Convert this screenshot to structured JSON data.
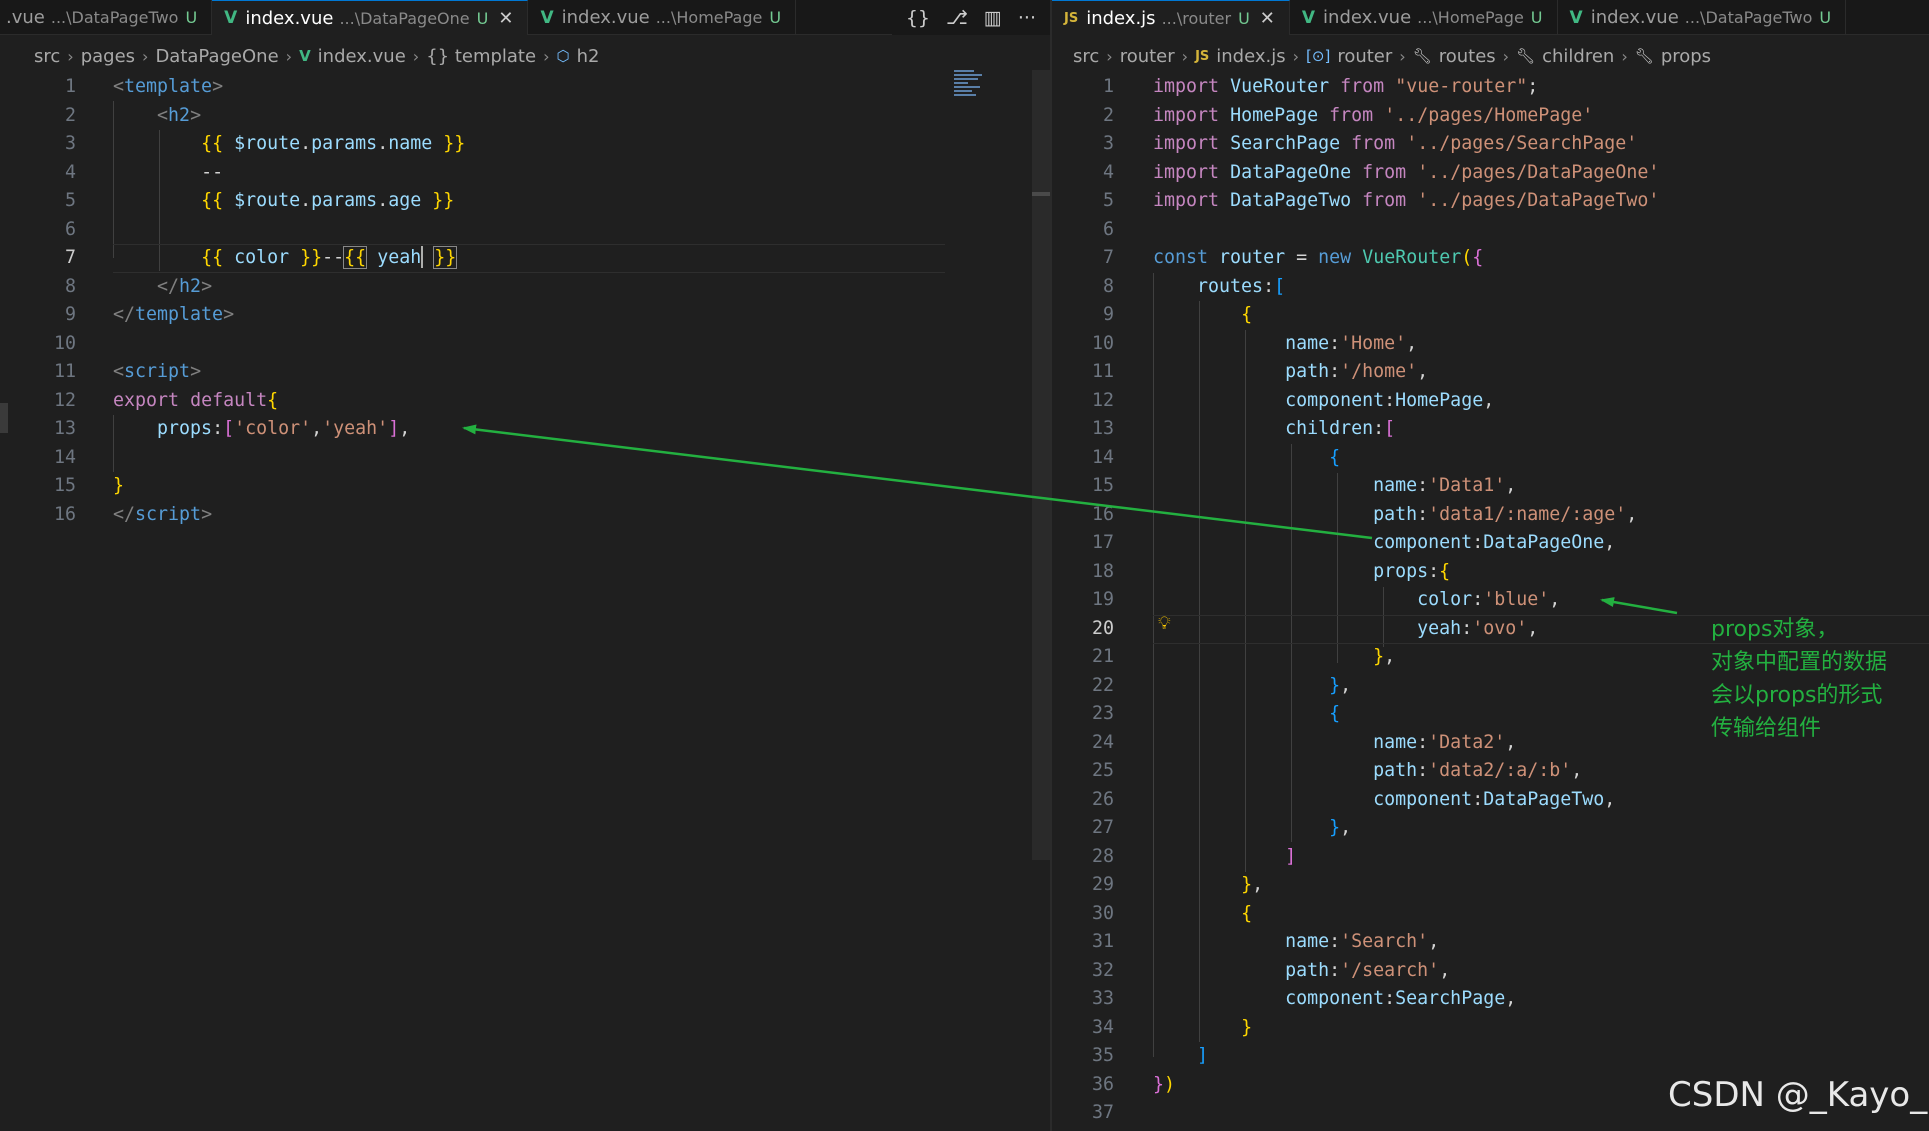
{
  "left_pane": {
    "tabs": [
      {
        "name": ".vue",
        "path": "...\\DataPageTwo",
        "status": "U"
      },
      {
        "name": "index.vue",
        "path": "...\\DataPageOne",
        "status": "U",
        "close": "✕"
      },
      {
        "name": "index.vue",
        "path": "...\\HomePage",
        "status": "U"
      }
    ],
    "actions": [
      "{}",
      "⎇",
      "▥",
      "···"
    ],
    "breadcrumb": [
      "src",
      "pages",
      "DataPageOne",
      "index.vue",
      "{} template",
      "h2"
    ],
    "line_numbers": [
      "1",
      "2",
      "3",
      "4",
      "5",
      "6",
      "7",
      "8",
      "9",
      "10",
      "11",
      "12",
      "13",
      "14",
      "15",
      "16"
    ],
    "current_line": "7"
  },
  "right_pane": {
    "tabs": [
      {
        "name": "index.js",
        "path": "...\\router",
        "status": "U",
        "close": "✕",
        "logo": "JS"
      },
      {
        "name": "index.vue",
        "path": "...\\HomePage",
        "status": "U"
      },
      {
        "name": "index.vue",
        "path": "...\\DataPageTwo",
        "status": "U"
      }
    ],
    "breadcrumb": [
      "src",
      "router",
      "index.js",
      "router",
      "routes",
      "children",
      "props"
    ],
    "line_numbers": [
      "1",
      "2",
      "3",
      "4",
      "5",
      "6",
      "7",
      "8",
      "9",
      "10",
      "11",
      "12",
      "13",
      "14",
      "15",
      "16",
      "17",
      "18",
      "19",
      "20",
      "21",
      "22",
      "23",
      "24",
      "25",
      "26",
      "27",
      "28",
      "29",
      "30",
      "31",
      "32",
      "33",
      "34",
      "35",
      "36",
      "37"
    ],
    "current_line": "20"
  },
  "annotation": {
    "lines": [
      "props对象，",
      "对象中配置的数据",
      "会以props的形式",
      "传输给组件"
    ],
    "color": "#23b040"
  },
  "watermark": "CSDN @_Kayo_",
  "icons": {
    "vue": "vue-logo-icon",
    "js": "js-file-icon",
    "bulb": "lightbulb-icon"
  }
}
